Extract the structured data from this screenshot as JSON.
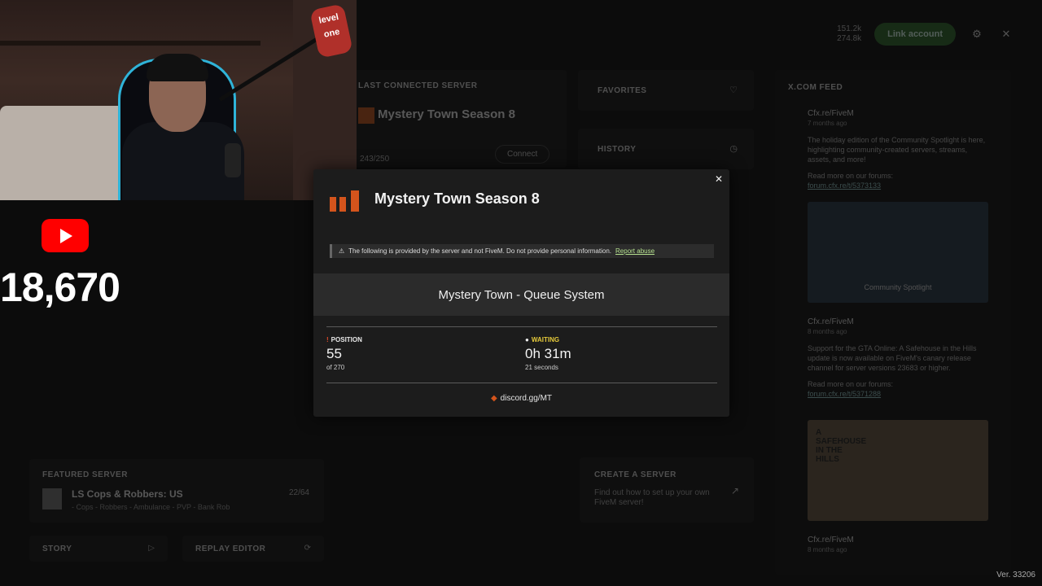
{
  "topbar": {
    "count1": "151.2k",
    "count2": "274.8k",
    "link_account": "Link account",
    "settings_icon": "gear-icon",
    "close_icon": "close-icon"
  },
  "last_connected": {
    "title": "LAST CONNECTED SERVER",
    "server_name": "Mystery Town Season 8",
    "players": "243/250",
    "connect": "Connect"
  },
  "favorites": {
    "title": "FAVORITES"
  },
  "history": {
    "title": "HISTORY"
  },
  "feed": {
    "title": "X.COM FEED",
    "posts": [
      {
        "author": "Cfx.re/FiveM",
        "ago": "7 months ago",
        "text": "The holiday edition of the Community Spotlight is here, highlighting community-created servers, streams, assets, and more!",
        "read_more": "Read more on our forums:",
        "link": "forum.cfx.re/t/5373133",
        "image_caption": "Community Spotlight"
      },
      {
        "author": "Cfx.re/FiveM",
        "ago": "8 months ago",
        "text": "Support for the GTA Online: A Safehouse in the Hills update is now available on FiveM's canary release channel for server versions 23683 or higher.",
        "read_more": "Read more on our forums:",
        "link": "forum.cfx.re/t/5371288",
        "image_caption": "A SAFEHOUSE IN THE HILLS"
      },
      {
        "author": "Cfx.re/FiveM",
        "ago": "8 months ago"
      }
    ]
  },
  "featured": {
    "title": "FEATURED SERVER",
    "name": "LS Cops & Robbers: US",
    "players": "22/64",
    "tags": "- Cops - Robbers - Ambulance - PVP - Bank Rob"
  },
  "story": {
    "title": "STORY"
  },
  "replay": {
    "title": "REPLAY EDITOR"
  },
  "create": {
    "title": "CREATE A SERVER",
    "desc": "Find out how to set up your own FiveM server!"
  },
  "version": "Ver. 33206",
  "overlay": {
    "sign": "level one",
    "yt_count": "18,670"
  },
  "modal": {
    "title": "Mystery Town Season 8",
    "warning": "The following is provided by the server and not FiveM. Do not provide personal information.",
    "report": "Report abuse",
    "queue_title": "Mystery Town - Queue System",
    "position_label": "POSITION",
    "position_value": "55",
    "position_sub": "of 270",
    "waiting_label": "WAITING",
    "waiting_value": "0h 31m",
    "waiting_sub": "21 seconds",
    "discord": "discord.gg/MT",
    "colors": {
      "accent": "#d4541c",
      "waiting": "#e5c93a",
      "report": "#b5e08f"
    }
  }
}
